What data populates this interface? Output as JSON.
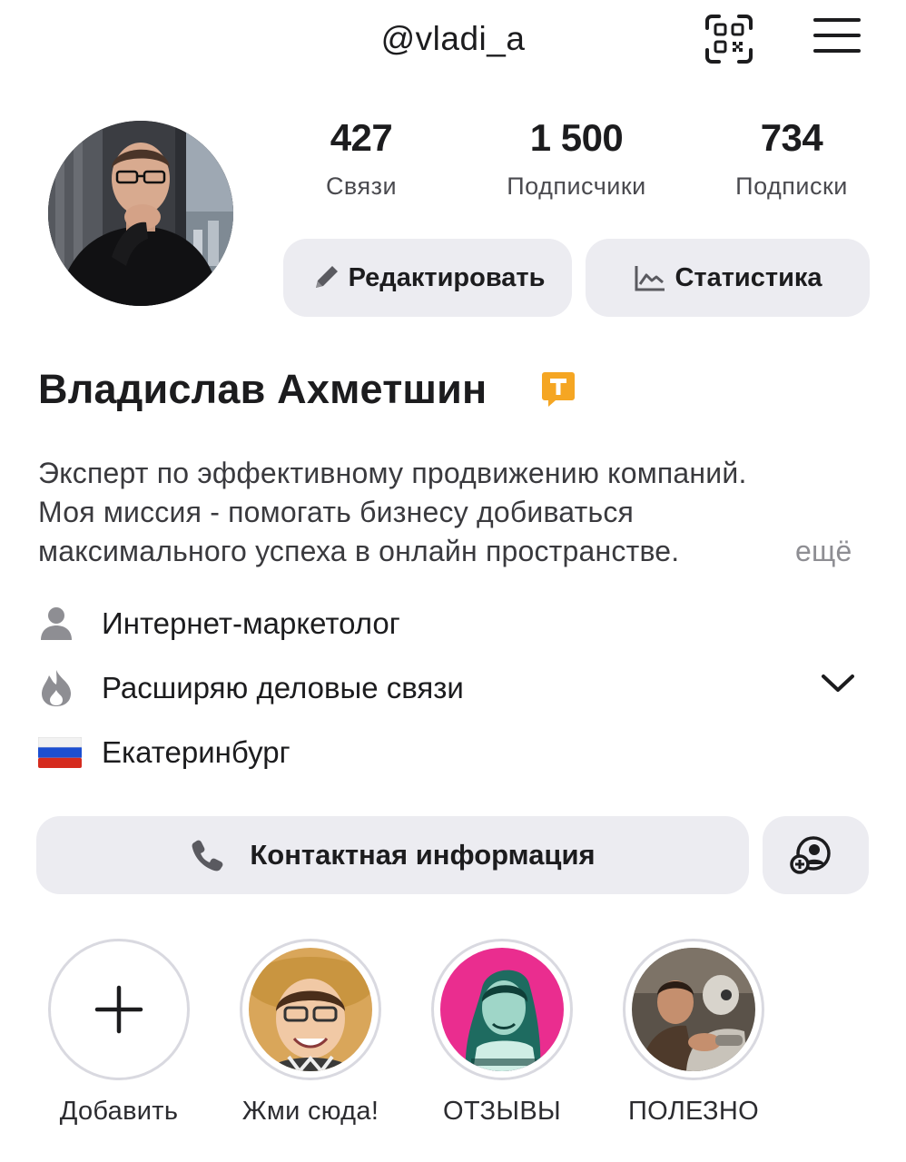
{
  "header": {
    "username": "@vladi_a",
    "qr_icon": "qr-code-icon",
    "menu_icon": "hamburger-menu-icon"
  },
  "profile": {
    "stats": [
      {
        "value": "427",
        "label": "Связи"
      },
      {
        "value": "1 500",
        "label": "Подписчики"
      },
      {
        "value": "734",
        "label": "Подписки"
      }
    ],
    "edit_label": "Редактировать",
    "stats_label": "Статистика",
    "name": "Владислав Ахметшин",
    "badge_icon": "verified-t-badge-icon",
    "bio_lines": [
      "Эксперт по эффективному продвижению компаний.",
      "Моя миссия - помогать бизнесу добиваться",
      "максимального успеха в онлайн пространстве."
    ],
    "bio_more": "ещё",
    "info": {
      "profession": "Интернет-маркетолог",
      "goal": "Расширяю деловые связи",
      "city": "Екатеринбург"
    },
    "contact_label": "Контактная информация"
  },
  "highlights": [
    {
      "label": "Добавить"
    },
    {
      "label": "Жми сюда!"
    },
    {
      "label": "ОТЗЫВЫ"
    },
    {
      "label": "ПОЛЕЗНО"
    }
  ],
  "colors": {
    "pill_bg": "#ececf1",
    "badge": "#f5a623",
    "reviews_bg": "#ea2d8f"
  }
}
